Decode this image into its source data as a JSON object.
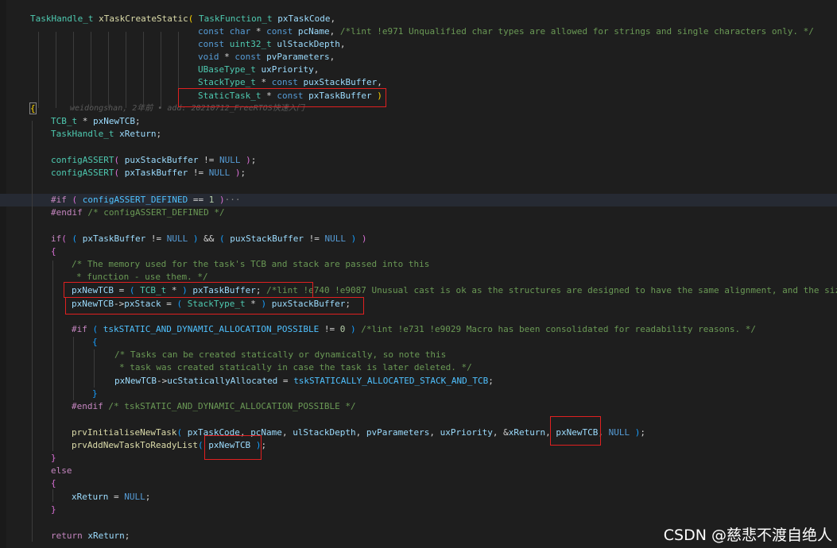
{
  "editor": {
    "code_lines": [
      "TaskHandle_t xTaskCreateStatic( TaskFunction_t pxTaskCode,",
      "const char * const pcName, /*lint !e971 Unqualified char types are allowed for strings and single characters only. */",
      "const uint32_t ulStackDepth,",
      "void * const pvParameters,",
      "UBaseType_t uxPriority,",
      "StackType_t * const puxStackBuffer,",
      "StaticTask_t * const pxTaskBuffer )",
      "{",
      "TCB_t * pxNewTCB;",
      "TaskHandle_t xReturn;",
      "configASSERT( puxStackBuffer != NULL );",
      "configASSERT( pxTaskBuffer != NULL );",
      "#if ( configASSERT_DEFINED == 1 )···",
      "#endif /* configASSERT_DEFINED */",
      "if( ( pxTaskBuffer != NULL ) && ( puxStackBuffer != NULL ) )",
      "{",
      "/* The memory used for the task's TCB and stack are passed into this",
      "* function - use them. */",
      "pxNewTCB = ( TCB_t * ) pxTaskBuffer; /*lint !e740 !e9087 Unusual cast is ok as the structures are designed to have the same alignment, and the siz",
      "pxNewTCB->pxStack = ( StackType_t * ) puxStackBuffer;",
      "#if ( tskSTATIC_AND_DYNAMIC_ALLOCATION_POSSIBLE != 0 ) /*lint !e731 !e9029 Macro has been consolidated for readability reasons. */",
      "{",
      "/* Tasks can be created statically or dynamically, so note this",
      "* task was created statically in case the task is later deleted. */",
      "pxNewTCB->ucStaticallyAllocated = tskSTATICALLY_ALLOCATED_STACK_AND_TCB;",
      "}",
      "#endif /* tskSTATIC_AND_DYNAMIC_ALLOCATION_POSSIBLE */",
      "prvInitialiseNewTask( pxTaskCode, pcName, ulStackDepth, pvParameters, uxPriority, &xReturn, pxNewTCB, NULL );",
      "prvAddNewTaskToReadyList( pxNewTCB );",
      "}",
      "else",
      "{",
      "xReturn = NULL;",
      "}",
      "return xReturn;"
    ],
    "blame_annotation": "weidongshan, 2年前 • add: 20210712_FreeRTOS快速入门",
    "watermark": "CSDN @慈悲不渡自绝人"
  },
  "colors": {
    "background": "#1e1e1e",
    "keyword": "#569cd6",
    "control": "#c586c0",
    "type": "#4ec9b0",
    "function": "#dcdcaa",
    "variable": "#9cdcfe",
    "comment": "#6a9955",
    "number": "#b5cea8",
    "macro": "#4fc1ff",
    "highlight_box": "#e02020"
  }
}
